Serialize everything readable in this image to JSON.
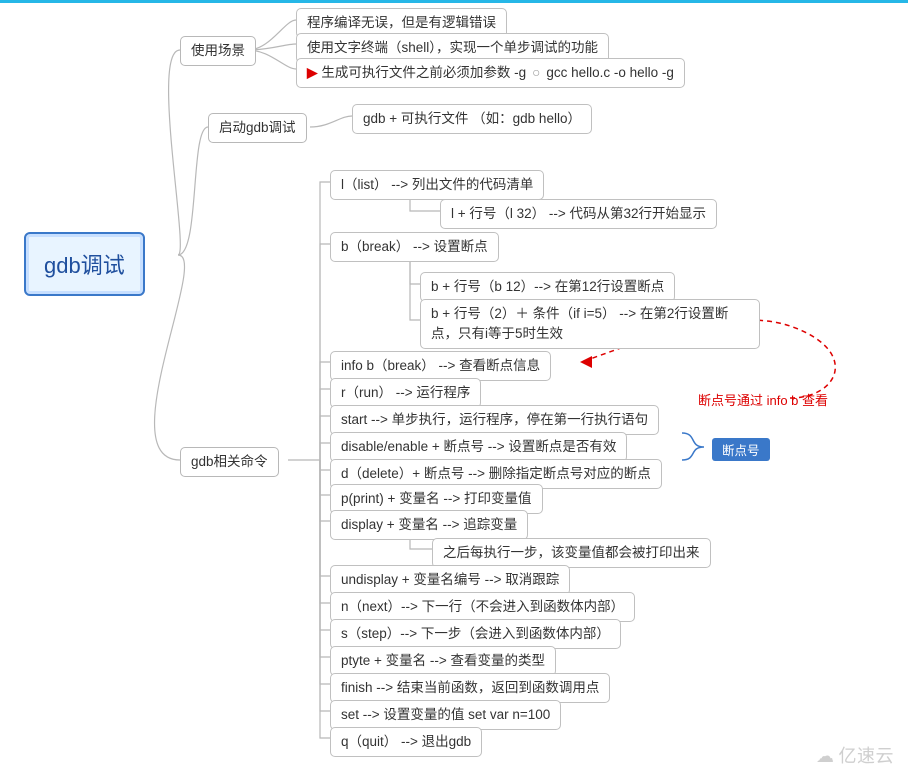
{
  "root": {
    "label": "gdb调试"
  },
  "branch1": {
    "label": "使用场景",
    "items": [
      "程序编译无误，但是有逻辑错误",
      "使用文字终端（shell），实现一个单步调试的功能"
    ],
    "marked": {
      "text1": "生成可执行文件之前必须加参数 -g",
      "text2": "gcc hello.c -o hello -g"
    }
  },
  "branch2": {
    "label": "启动gdb调试",
    "item": "gdb + 可执行文件 （如：gdb hello）"
  },
  "branch3": {
    "label": "gdb相关命令",
    "list": {
      "n1": "l（list） --> 列出文件的代码清单",
      "n1a": "l + 行号（l 32） --> 代码从第32行开始显示",
      "n2": "b（break） --> 设置断点",
      "n2a": "b + 行号（b 12）--> 在第12行设置断点",
      "n2b": "b + 行号（2）＋ 条件（if i=5） --> 在第2行设置断点，只有i等于5时生效",
      "n3": "info b（break） --> 查看断点信息",
      "n4": "r（run） --> 运行程序",
      "n5": "start --> 单步执行，运行程序，停在第一行执行语句",
      "n6": "disable/enable + 断点号 --> 设置断点是否有效",
      "n7": "d（delete）+ 断点号 --> 删除指定断点号对应的断点",
      "n8": "p(print) + 变量名 --> 打印变量值",
      "n9": "display + 变量名 --> 追踪变量",
      "n9a": "之后每执行一步，该变量值都会被打印出来",
      "n10": "undisplay + 变量名编号 --> 取消跟踪",
      "n11": "n（next）--> 下一行（不会进入到函数体内部）",
      "n12": "s（step）--> 下一步（会进入到函数体内部）",
      "n13": "ptyte + 变量名 --> 查看变量的类型",
      "n14": "finish --> 结束当前函数，返回到函数调用点",
      "n15": "set --> 设置变量的值 set var n=100",
      "n16": "q（quit） --> 退出gdb"
    }
  },
  "annotations": {
    "red_text": "断点号通过 info b 查看",
    "tag": "断点号"
  },
  "watermark": "亿速云"
}
